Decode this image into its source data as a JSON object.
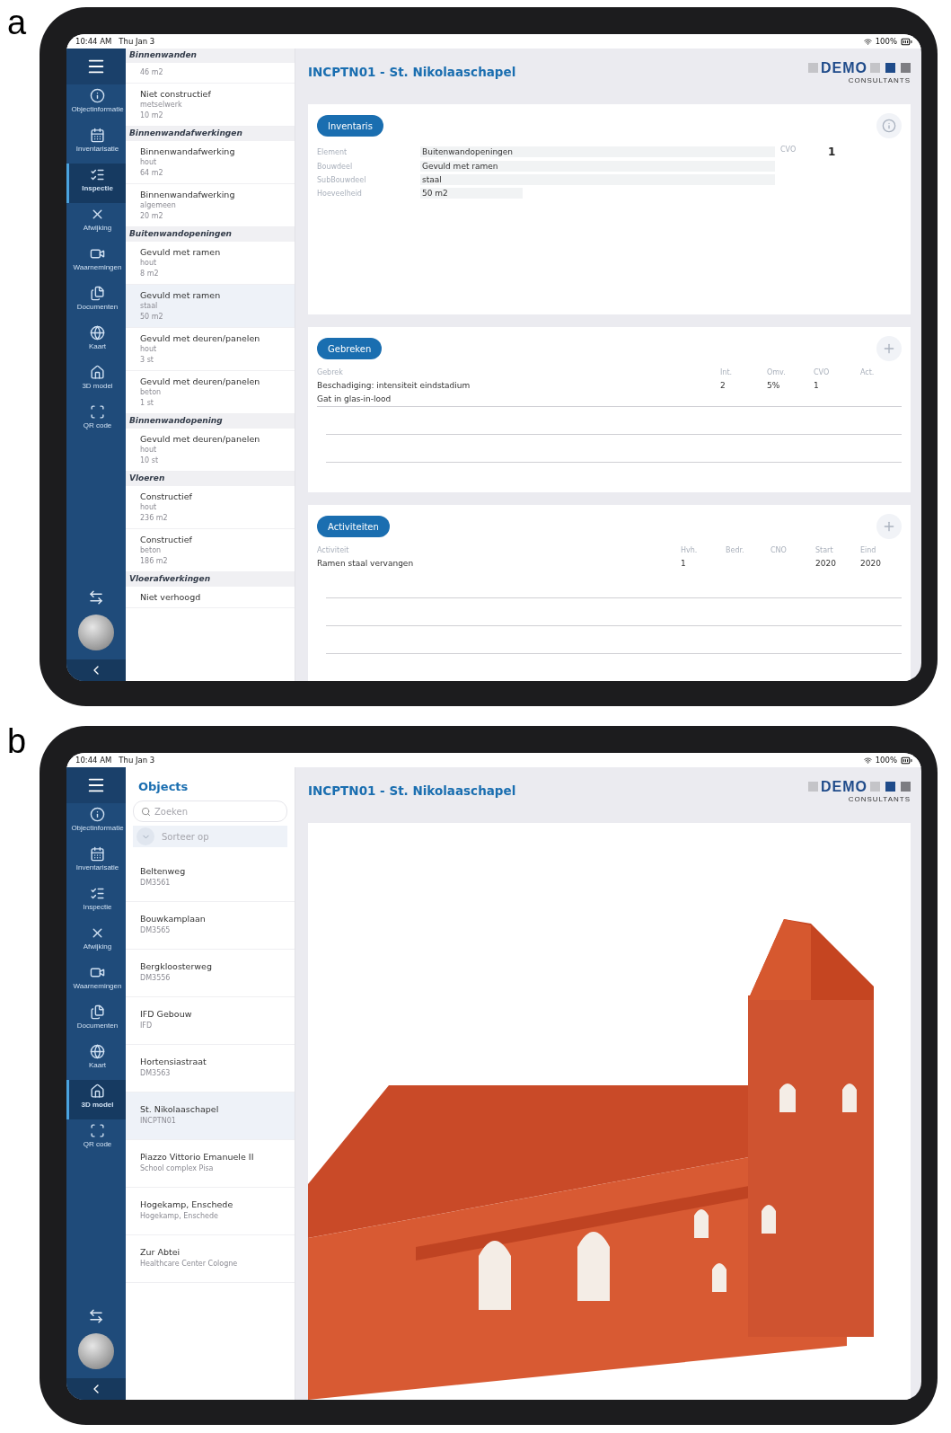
{
  "panels": [
    {
      "label": "a",
      "status_bar": {
        "time": "10:44 AM",
        "date": "Thu Jan 3",
        "battery": "100%"
      },
      "nav": [
        {
          "label": "Objectinformatie",
          "selected": false
        },
        {
          "label": "Inventarisatie",
          "selected": false
        },
        {
          "label": "Inspectie",
          "selected": true
        },
        {
          "label": "Afwijking",
          "selected": false
        },
        {
          "label": "Waarnemingen",
          "selected": false
        },
        {
          "label": "Documenten",
          "selected": false
        },
        {
          "label": "Kaart",
          "selected": false
        },
        {
          "label": "3D model",
          "selected": false
        },
        {
          "label": "QR code",
          "selected": false
        }
      ],
      "list": {
        "kind": "grouped",
        "groups": [
          {
            "title": "Binnenwanden",
            "items": [
              {
                "lines": [
                  "46 m2"
                ],
                "selected": false
              },
              {
                "title": "Niet constructief",
                "lines": [
                  "metselwerk",
                  "10 m2"
                ],
                "selected": false
              }
            ]
          },
          {
            "title": "Binnenwandafwerkingen",
            "items": [
              {
                "title": "Binnenwandafwerking",
                "lines": [
                  "hout",
                  "64 m2"
                ],
                "selected": false
              },
              {
                "title": "Binnenwandafwerking",
                "lines": [
                  "algemeen",
                  "20 m2"
                ],
                "selected": false
              }
            ]
          },
          {
            "title": "Buitenwandopeningen",
            "items": [
              {
                "title": "Gevuld met ramen",
                "lines": [
                  "hout",
                  "8 m2"
                ],
                "selected": false
              },
              {
                "title": "Gevuld met ramen",
                "lines": [
                  "staal",
                  "50 m2"
                ],
                "selected": true
              },
              {
                "title": "Gevuld met deuren/panelen",
                "lines": [
                  "hout",
                  "3 st"
                ],
                "selected": false
              },
              {
                "title": "Gevuld met deuren/panelen",
                "lines": [
                  "beton",
                  "1 st"
                ],
                "selected": false
              }
            ]
          },
          {
            "title": "Binnenwandopening",
            "items": [
              {
                "title": "Gevuld met deuren/panelen",
                "lines": [
                  "hout",
                  "10 st"
                ],
                "selected": false
              }
            ]
          },
          {
            "title": "Vloeren",
            "items": [
              {
                "title": "Constructief",
                "lines": [
                  "hout",
                  "236 m2"
                ],
                "selected": false
              },
              {
                "title": "Constructief",
                "lines": [
                  "beton",
                  "186 m2"
                ],
                "selected": false
              }
            ]
          },
          {
            "title": "Vloerafwerkingen",
            "items": [
              {
                "title": "Niet verhoogd",
                "selected": false
              }
            ]
          }
        ]
      },
      "content": {
        "kind": "inspection",
        "title": "INCPTN01 - St. Nikolaaschapel",
        "logo": {
          "text": "DEMO",
          "subtitle": "CONSULTANTS"
        },
        "inventory": {
          "button": "Inventaris",
          "fields": [
            {
              "label": "Element",
              "value": "Buitenwandopeningen"
            },
            {
              "label": "Bouwdeel",
              "value": "Gevuld met ramen"
            },
            {
              "label": "SubBouwdeel",
              "value": "staal"
            },
            {
              "label": "Hoeveelheid",
              "value": "50 m2"
            }
          ],
          "cvo": {
            "label": "CVO",
            "value": "1"
          }
        },
        "tables": [
          {
            "button": "Gebreken",
            "columns": [
              "Gebrek",
              "Int.",
              "Omv.",
              "CVO",
              "Act."
            ],
            "rows": [
              {
                "cells": [
                  "Beschadiging: intensiteit eindstadium",
                  "2",
                  "5%",
                  "1",
                  null
                ],
                "note": "Gat in glas-in-lood"
              }
            ]
          },
          {
            "button": "Activiteiten",
            "columns": [
              "Activiteit",
              "Hvh.",
              "Bedr.",
              "CNO",
              "Start",
              "Eind"
            ],
            "rows": [
              {
                "cells": [
                  "Ramen staal vervangen",
                  "1",
                  null,
                  null,
                  "2020",
                  "2020"
                ]
              }
            ]
          }
        ]
      }
    },
    {
      "label": "b",
      "status_bar": {
        "time": "10:44 AM",
        "date": "Thu Jan 3",
        "battery": "100%"
      },
      "nav": [
        {
          "label": "Objectinformatie",
          "selected": false
        },
        {
          "label": "Inventarisatie",
          "selected": false
        },
        {
          "label": "Inspectie",
          "selected": false
        },
        {
          "label": "Afwijking",
          "selected": false
        },
        {
          "label": "Waarnemingen",
          "selected": false
        },
        {
          "label": "Documenten",
          "selected": false
        },
        {
          "label": "Kaart",
          "selected": false
        },
        {
          "label": "3D model",
          "selected": true
        },
        {
          "label": "QR code",
          "selected": false
        }
      ],
      "list": {
        "kind": "objects",
        "title": "Objects",
        "search": {
          "placeholder": "Zoeken"
        },
        "sort": {
          "placeholder": "Sorteer op"
        },
        "items": [
          {
            "title": "Beltenweg",
            "lines": [
              "DM3561"
            ],
            "selected": false
          },
          {
            "title": "Bouwkamplaan",
            "lines": [
              "DM3565"
            ],
            "selected": false
          },
          {
            "title": "Bergkloosterweg",
            "lines": [
              "DM3556"
            ],
            "selected": false
          },
          {
            "title": "IFD Gebouw",
            "lines": [
              "IFD"
            ],
            "selected": false
          },
          {
            "title": "Hortensiastraat",
            "lines": [
              "DM3563"
            ],
            "selected": false
          },
          {
            "title": "St. Nikolaaschapel",
            "lines": [
              "INCPTN01"
            ],
            "selected": true
          },
          {
            "title": "Piazzo Vittorio Emanuele II",
            "lines": [
              "School complex Pisa"
            ],
            "selected": false
          },
          {
            "title": "Hogekamp, Enschede",
            "lines": [
              "Hogekamp, Enschede"
            ],
            "selected": false
          },
          {
            "title": "Zur Abtei",
            "lines": [
              "Healthcare Center Cologne"
            ],
            "selected": false
          }
        ]
      },
      "content": {
        "kind": "model",
        "title": "INCPTN01 - St. Nikolaaschapel",
        "logo": {
          "text": "DEMO",
          "subtitle": "CONSULTANTS"
        }
      }
    }
  ]
}
